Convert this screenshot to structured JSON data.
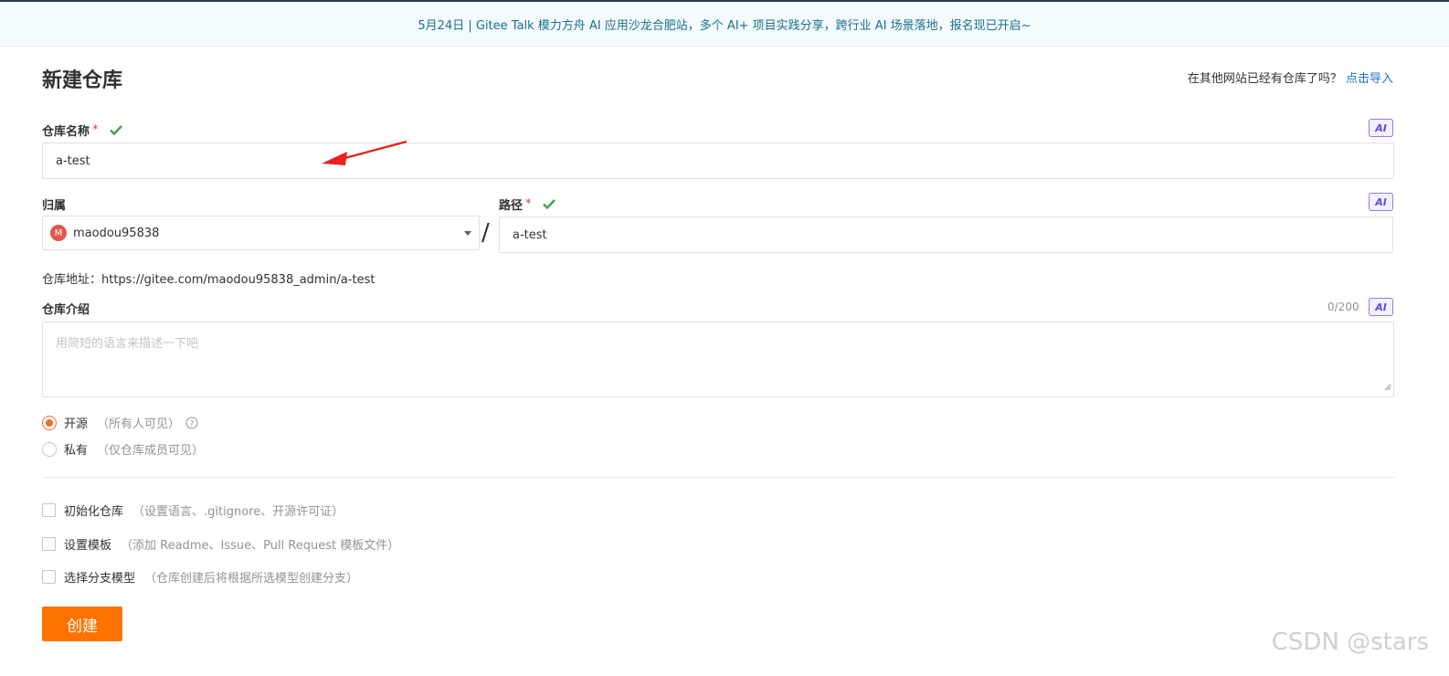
{
  "banner": {
    "text": "5月24日 | Gitee Talk 模力方舟 AI 应用沙龙合肥站，多个 AI+ 项目实践分享，跨行业 AI 场景落地，报名现已开启~"
  },
  "page": {
    "title": "新建仓库",
    "import_prefix": "在其他网站已经有仓库了吗？",
    "import_link": "点击导入"
  },
  "repo_name": {
    "label": "仓库名称",
    "required_mark": "*",
    "value": "a-test",
    "ai_label": "AI"
  },
  "owner": {
    "label": "归属",
    "avatar_letter": "M",
    "value": "maodou95838"
  },
  "separator": "/",
  "path": {
    "label": "路径",
    "required_mark": "*",
    "value": "a-test",
    "ai_label": "AI"
  },
  "address": {
    "text": "仓库地址：https://gitee.com/maodou95838_admin/a-test"
  },
  "description": {
    "label": "仓库介绍",
    "counter": "0/200",
    "ai_label": "AI",
    "placeholder": "用简短的语言来描述一下吧"
  },
  "visibility": {
    "options": [
      {
        "label": "开源",
        "hint": "（所有人可见）",
        "selected": true
      },
      {
        "label": "私有",
        "hint": "（仅仓库成员可见）",
        "selected": false
      }
    ]
  },
  "extras": [
    {
      "label": "初始化仓库",
      "hint": "（设置语言、.gitignore、开源许可证）",
      "checked": false
    },
    {
      "label": "设置模板",
      "hint": "（添加 Readme、Issue、Pull Request 模板文件）",
      "checked": false
    },
    {
      "label": "选择分支模型",
      "hint": "（仓库创建后将根据所选模型创建分支）",
      "checked": false
    }
  ],
  "create_button": "创建",
  "watermark": "CSDN @stars",
  "colors": {
    "accent": "#fe7300",
    "link": "#1a73c9",
    "check": "#3fa34d",
    "annotation": "#e8211c"
  }
}
